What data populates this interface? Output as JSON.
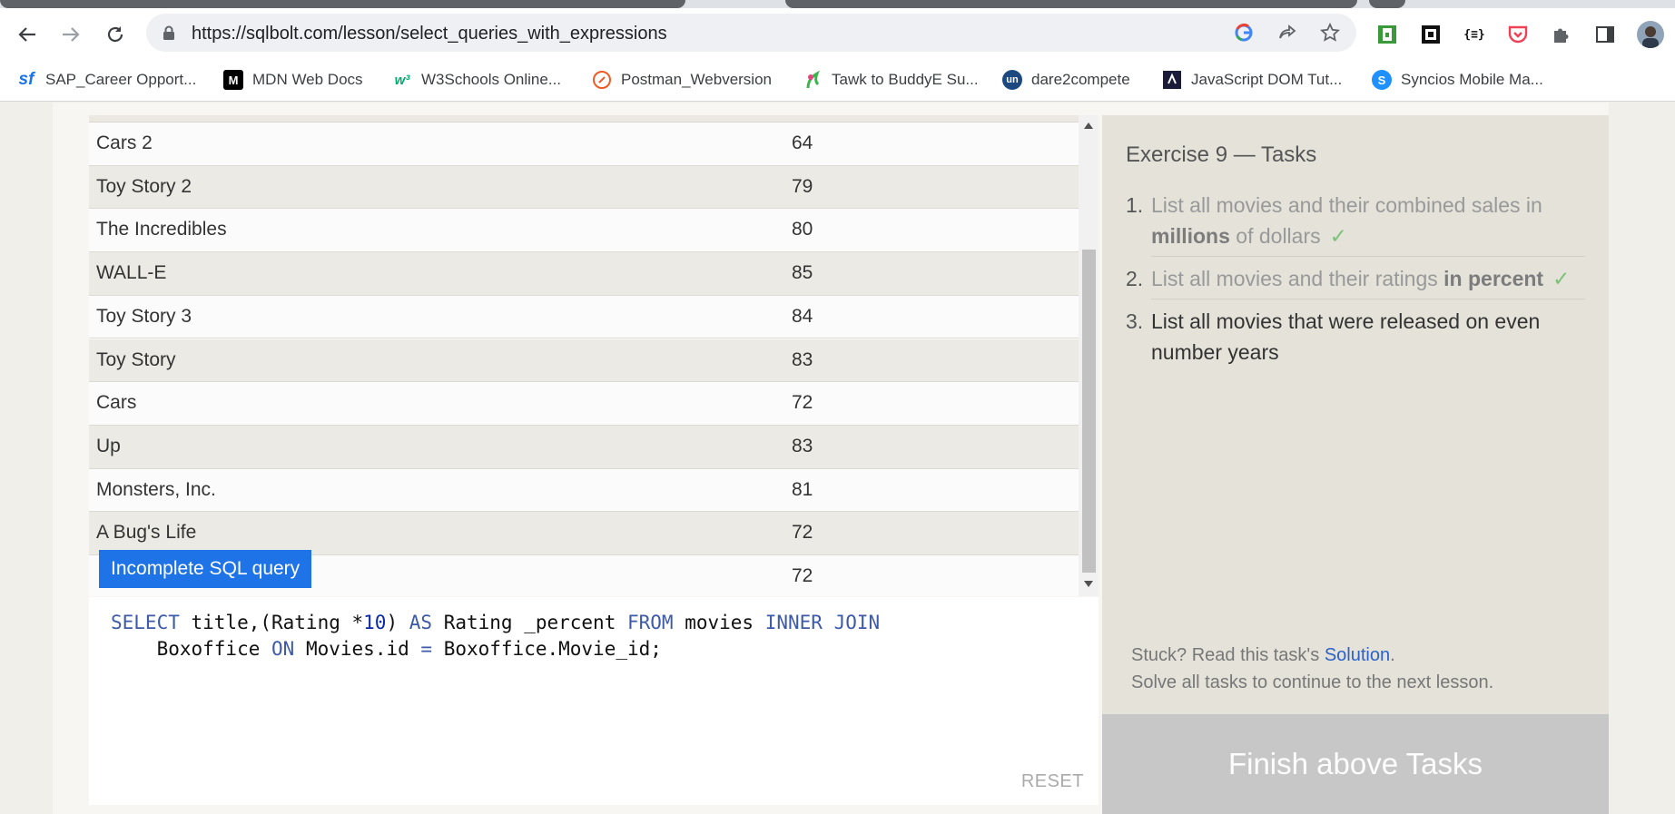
{
  "browser": {
    "url": "https://sqlbolt.com/lesson/select_queries_with_expressions",
    "bookmarks": [
      {
        "label": "SAP_Career Opport...",
        "icon": "sf",
        "color": "#1a73e8"
      },
      {
        "label": "MDN Web Docs",
        "icon": "M",
        "color": "#000000"
      },
      {
        "label": "W3Schools Online...",
        "icon": "w3",
        "color": "#04aa6d"
      },
      {
        "label": "Postman_Webversion",
        "icon": "postman",
        "color": "#ef5b25"
      },
      {
        "label": "Tawk to BuddyE Su...",
        "icon": "tawk",
        "color": "#39b54a"
      },
      {
        "label": "dare2compete",
        "icon": "un",
        "color": "#1c4980"
      },
      {
        "label": "JavaScript DOM Tut...",
        "icon": "js",
        "color": "#1b1b3a"
      },
      {
        "label": "Syncios Mobile Ma...",
        "icon": "s",
        "color": "#1e90ff"
      }
    ]
  },
  "results": {
    "rows": [
      {
        "title": "Cars 2",
        "value": "64"
      },
      {
        "title": "Toy Story 2",
        "value": "79"
      },
      {
        "title": "The Incredibles",
        "value": "80"
      },
      {
        "title": "WALL-E",
        "value": "85"
      },
      {
        "title": "Toy Story 3",
        "value": "84"
      },
      {
        "title": "Toy Story",
        "value": "83"
      },
      {
        "title": "Cars",
        "value": "72"
      },
      {
        "title": "Up",
        "value": "83"
      },
      {
        "title": "Monsters, Inc.",
        "value": "81"
      },
      {
        "title": "A Bug's Life",
        "value": "72"
      },
      {
        "title": "",
        "value": "72"
      }
    ],
    "tooltip": "Incomplete SQL query"
  },
  "editor": {
    "reset_label": "RESET"
  },
  "tasks": {
    "title": "Exercise 9 — Tasks",
    "items": [
      {
        "num": "1.",
        "text_a": "List all movies and their combined sales in ",
        "bold": "millions",
        "text_b": " of dollars",
        "check": "✓"
      },
      {
        "num": "2.",
        "text_a": "List all movies and their ratings ",
        "bold": "in percent",
        "text_b": "",
        "check": "✓"
      },
      {
        "num": "3.",
        "text_a": "List all movies that were released on even number years",
        "bold": "",
        "text_b": "",
        "check": ""
      }
    ],
    "stuck_prefix": "Stuck? Read this task's ",
    "solution_link": "Solution",
    "stuck_suffix": ".",
    "continue_text": "Solve all tasks to continue to the next lesson.",
    "finish_button": "Finish above Tasks"
  }
}
